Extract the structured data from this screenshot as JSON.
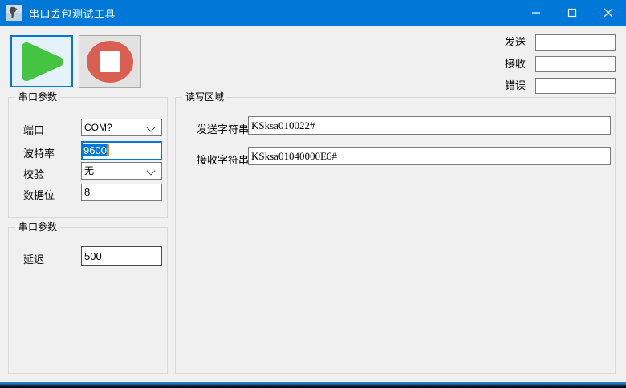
{
  "titlebar": {
    "title": "串口丢包测试工具"
  },
  "toolbar": {
    "play_icon": "play-icon",
    "stop_icon": "stop-icon"
  },
  "status_fields": {
    "send_label": "发送",
    "send_value": "",
    "receive_label": "接收",
    "receive_value": "",
    "error_label": "错误",
    "error_value": ""
  },
  "serial_params": {
    "title": "串口参数",
    "port_label": "端口",
    "port_value": "COM?",
    "baud_label": "波特率",
    "baud_value": "9600",
    "parity_label": "校验",
    "parity_value": "无",
    "databits_label": "数据位",
    "databits_value": "8"
  },
  "delay_params": {
    "title": "串口参数",
    "delay_label": "延迟",
    "delay_value": "500"
  },
  "rw_area": {
    "title": "读写区域",
    "send_label": "发送字符串",
    "send_value": "KSksa010022#",
    "receive_label": "接收字符串",
    "receive_value": "KSksa01040000E6#"
  },
  "colors": {
    "titlebar_blue": "#0078d7",
    "accent_blue": "#0078d7",
    "play_green": "#44c441",
    "stop_red": "#d95f52",
    "background": "#f0f0f0",
    "caret_orange": "#e0862c"
  }
}
